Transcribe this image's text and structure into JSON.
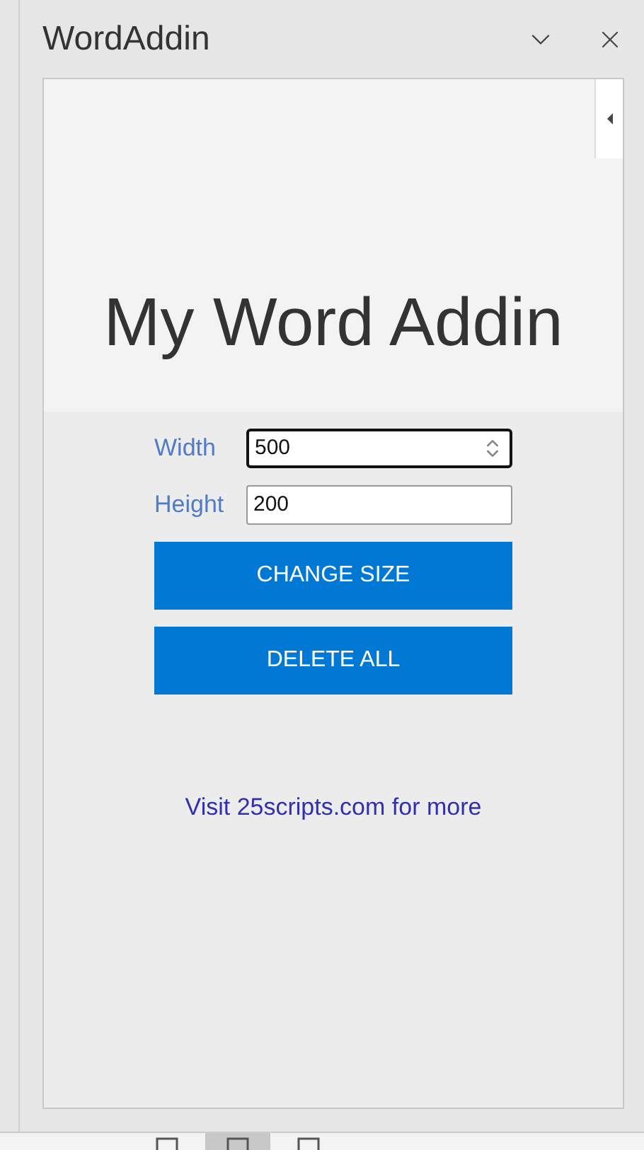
{
  "pane": {
    "title": "WordAddin"
  },
  "hero": {
    "heading": "My Word Addin"
  },
  "fields": [
    {
      "label": "Width",
      "value": "500",
      "focused": true
    },
    {
      "label": "Height",
      "value": "200",
      "focused": false
    }
  ],
  "buttons": [
    "CHANGE SIZE",
    "DELETE ALL"
  ],
  "link": "Visit 25scripts.com for more",
  "status_bar": {
    "views": [
      {
        "selected": false
      },
      {
        "selected": true
      },
      {
        "selected": false
      }
    ]
  }
}
